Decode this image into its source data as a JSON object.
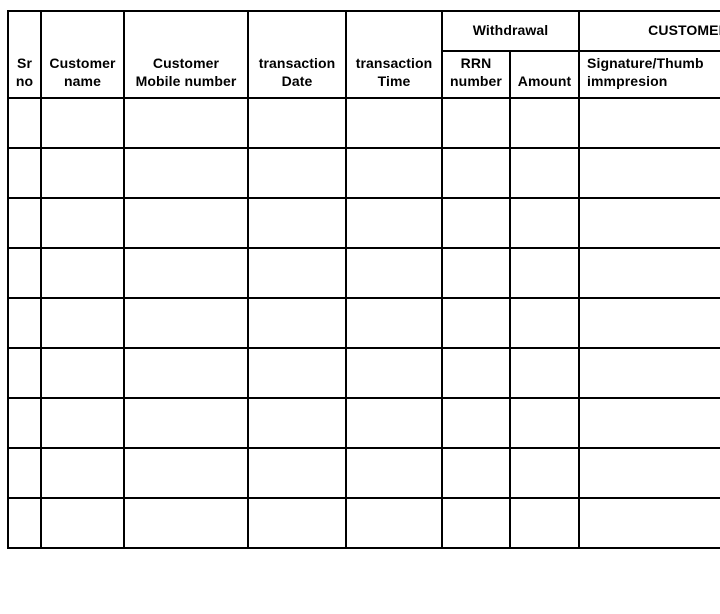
{
  "document": {
    "kind": "blank-ruled-register-table",
    "background_color": "#ffffff",
    "line_color": "#000000",
    "text_color": "#000000"
  },
  "table": {
    "group_headers": [
      {
        "label": "Withdrawal",
        "spans": 2,
        "align": "center"
      },
      {
        "label": "CUSTOMER",
        "spans": 1,
        "align": "center"
      }
    ],
    "columns": [
      {
        "key": "sr_no",
        "label": "Sr\nno",
        "line1": "Sr",
        "line2": "no",
        "align": "center",
        "group": null
      },
      {
        "key": "cust_name",
        "label": "Customer\nname",
        "line1": "Customer",
        "line2": "name",
        "align": "center",
        "group": null
      },
      {
        "key": "mobile",
        "label": "Customer\nMobile number",
        "line1": "Customer",
        "line2": "Mobile number",
        "align": "center",
        "group": null
      },
      {
        "key": "txn_date",
        "label": "transaction\nDate",
        "line1": "transaction",
        "line2": "Date",
        "align": "center",
        "group": null
      },
      {
        "key": "txn_time",
        "label": "transaction\nTime",
        "line1": "transaction",
        "line2": "Time",
        "align": "center",
        "group": null
      },
      {
        "key": "rrn",
        "label": "RRN\nnumber",
        "line1": "RRN",
        "line2": "number",
        "align": "center",
        "group": "Withdrawal"
      },
      {
        "key": "amount",
        "label": "Amount",
        "line1": "",
        "line2": "Amount",
        "align": "center",
        "group": "Withdrawal"
      },
      {
        "key": "signature",
        "label": "Signature/Thumb\nimmpresion",
        "line1": "Signature/Thumb",
        "line2": "immpresion",
        "align": "left",
        "group": "CUSTOMER"
      }
    ],
    "row_count": 9,
    "rows": [
      {
        "sr_no": "",
        "cust_name": "",
        "mobile": "",
        "txn_date": "",
        "txn_time": "",
        "rrn": "",
        "amount": "",
        "signature": ""
      },
      {
        "sr_no": "",
        "cust_name": "",
        "mobile": "",
        "txn_date": "",
        "txn_time": "",
        "rrn": "",
        "amount": "",
        "signature": ""
      },
      {
        "sr_no": "",
        "cust_name": "",
        "mobile": "",
        "txn_date": "",
        "txn_time": "",
        "rrn": "",
        "amount": "",
        "signature": ""
      },
      {
        "sr_no": "",
        "cust_name": "",
        "mobile": "",
        "txn_date": "",
        "txn_time": "",
        "rrn": "",
        "amount": "",
        "signature": ""
      },
      {
        "sr_no": "",
        "cust_name": "",
        "mobile": "",
        "txn_date": "",
        "txn_time": "",
        "rrn": "",
        "amount": "",
        "signature": ""
      },
      {
        "sr_no": "",
        "cust_name": "",
        "mobile": "",
        "txn_date": "",
        "txn_time": "",
        "rrn": "",
        "amount": "",
        "signature": ""
      },
      {
        "sr_no": "",
        "cust_name": "",
        "mobile": "",
        "txn_date": "",
        "txn_time": "",
        "rrn": "",
        "amount": "",
        "signature": ""
      },
      {
        "sr_no": "",
        "cust_name": "",
        "mobile": "",
        "txn_date": "",
        "txn_time": "",
        "rrn": "",
        "amount": "",
        "signature": ""
      },
      {
        "sr_no": "",
        "cust_name": "",
        "mobile": "",
        "txn_date": "",
        "txn_time": "",
        "rrn": "",
        "amount": "",
        "signature": ""
      }
    ]
  }
}
